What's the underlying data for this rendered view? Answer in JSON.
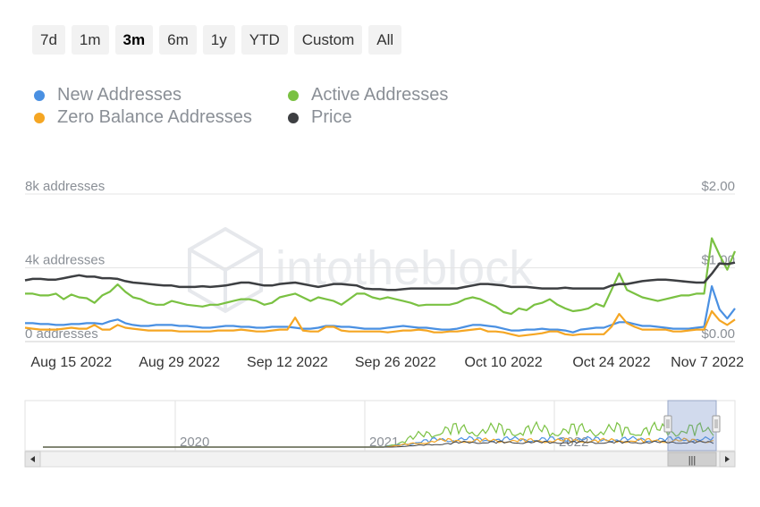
{
  "range_selector": {
    "buttons": [
      {
        "label": "7d"
      },
      {
        "label": "1m"
      },
      {
        "label": "3m"
      },
      {
        "label": "6m"
      },
      {
        "label": "1y"
      },
      {
        "label": "YTD"
      },
      {
        "label": "Custom"
      },
      {
        "label": "All"
      }
    ],
    "active": "3m"
  },
  "legend": {
    "items": [
      {
        "label": "New Addresses",
        "color": "#4a90e2"
      },
      {
        "label": "Active Addresses",
        "color": "#7ac142"
      },
      {
        "label": "Zero Balance Addresses",
        "color": "#f5a623"
      },
      {
        "label": "Price",
        "color": "#3d3f42"
      }
    ]
  },
  "watermark": "intotheblock",
  "navigator": {
    "year_labels": [
      "2020",
      "2021",
      "2022"
    ],
    "scroll_handle": "|||"
  },
  "chart_data": {
    "type": "line",
    "x_dates": [
      "2022-08-09",
      "2022-08-10",
      "2022-08-11",
      "2022-08-12",
      "2022-08-13",
      "2022-08-14",
      "2022-08-15",
      "2022-08-16",
      "2022-08-17",
      "2022-08-18",
      "2022-08-19",
      "2022-08-20",
      "2022-08-21",
      "2022-08-22",
      "2022-08-23",
      "2022-08-24",
      "2022-08-25",
      "2022-08-26",
      "2022-08-27",
      "2022-08-28",
      "2022-08-29",
      "2022-08-30",
      "2022-08-31",
      "2022-09-01",
      "2022-09-02",
      "2022-09-03",
      "2022-09-04",
      "2022-09-05",
      "2022-09-06",
      "2022-09-07",
      "2022-09-08",
      "2022-09-09",
      "2022-09-10",
      "2022-09-11",
      "2022-09-12",
      "2022-09-13",
      "2022-09-14",
      "2022-09-15",
      "2022-09-16",
      "2022-09-17",
      "2022-09-18",
      "2022-09-19",
      "2022-09-20",
      "2022-09-21",
      "2022-09-22",
      "2022-09-23",
      "2022-09-24",
      "2022-09-25",
      "2022-09-26",
      "2022-09-27",
      "2022-09-28",
      "2022-09-29",
      "2022-09-30",
      "2022-10-01",
      "2022-10-02",
      "2022-10-03",
      "2022-10-04",
      "2022-10-05",
      "2022-10-06",
      "2022-10-07",
      "2022-10-08",
      "2022-10-09",
      "2022-10-10",
      "2022-10-11",
      "2022-10-12",
      "2022-10-13",
      "2022-10-14",
      "2022-10-15",
      "2022-10-16",
      "2022-10-17",
      "2022-10-18",
      "2022-10-19",
      "2022-10-20",
      "2022-10-21",
      "2022-10-22",
      "2022-10-23",
      "2022-10-24",
      "2022-10-25",
      "2022-10-26",
      "2022-10-27",
      "2022-10-28",
      "2022-10-29",
      "2022-10-30",
      "2022-10-31",
      "2022-11-01",
      "2022-11-02",
      "2022-11-03",
      "2022-11-04",
      "2022-11-05",
      "2022-11-06",
      "2022-11-07",
      "2022-11-08",
      "2022-11-09"
    ],
    "x_tick_labels": [
      {
        "label": "Aug 15 2022",
        "date": "2022-08-15"
      },
      {
        "label": "Aug 29 2022",
        "date": "2022-08-29"
      },
      {
        "label": "Sep 12 2022",
        "date": "2022-09-12"
      },
      {
        "label": "Sep 26 2022",
        "date": "2022-09-26"
      },
      {
        "label": "Oct 10 2022",
        "date": "2022-10-10"
      },
      {
        "label": "Oct 24 2022",
        "date": "2022-10-24"
      },
      {
        "label": "Nov 7 2022",
        "date": "2022-11-07"
      }
    ],
    "y_left": {
      "ticks": [
        {
          "v": 0,
          "label": "0 addresses"
        },
        {
          "v": 4000,
          "label": "4k addresses"
        },
        {
          "v": 8000,
          "label": "8k addresses"
        }
      ],
      "ylim": [
        0,
        8000
      ]
    },
    "y_right": {
      "ticks": [
        {
          "v": 0,
          "label": "$0.00"
        },
        {
          "v": 1,
          "label": "$1.00"
        },
        {
          "v": 2,
          "label": "$2.00"
        }
      ],
      "ylim": [
        0,
        2
      ]
    },
    "grid": true,
    "series": [
      {
        "name": "New Addresses",
        "axis": "left",
        "color": "#4a90e2",
        "values": [
          1000,
          1000,
          950,
          950,
          900,
          900,
          950,
          950,
          1000,
          1000,
          950,
          1100,
          1200,
          1000,
          900,
          850,
          850,
          900,
          900,
          900,
          850,
          850,
          800,
          750,
          750,
          800,
          850,
          850,
          800,
          800,
          750,
          750,
          800,
          800,
          800,
          750,
          700,
          700,
          750,
          850,
          850,
          800,
          800,
          750,
          700,
          700,
          700,
          750,
          800,
          850,
          800,
          750,
          750,
          700,
          650,
          650,
          700,
          800,
          900,
          900,
          850,
          800,
          700,
          600,
          600,
          650,
          650,
          700,
          650,
          650,
          600,
          500,
          650,
          700,
          750,
          750,
          900,
          1050,
          1050,
          950,
          850,
          850,
          800,
          750,
          700,
          700,
          700,
          750,
          800,
          3000,
          1750,
          1250,
          1800
        ]
      },
      {
        "name": "Active Addresses",
        "axis": "left",
        "color": "#7ac142",
        "values": [
          2600,
          2600,
          2500,
          2500,
          2600,
          2300,
          2550,
          2400,
          2350,
          2100,
          2500,
          2700,
          3100,
          2700,
          2400,
          2300,
          2100,
          2000,
          2000,
          2200,
          2100,
          2000,
          1950,
          1900,
          2000,
          2000,
          2100,
          2200,
          2300,
          2300,
          2200,
          2000,
          2100,
          2400,
          2500,
          2600,
          2400,
          2200,
          2400,
          2300,
          2200,
          2000,
          2300,
          2600,
          2600,
          2400,
          2300,
          2400,
          2300,
          2200,
          2100,
          1950,
          2000,
          2000,
          2000,
          2000,
          2100,
          2300,
          2400,
          2300,
          2100,
          1900,
          1600,
          1500,
          1800,
          1700,
          2000,
          2100,
          2300,
          2000,
          1800,
          1650,
          1700,
          1800,
          2050,
          1900,
          2800,
          3700,
          2800,
          2600,
          2400,
          2300,
          2200,
          2300,
          2400,
          2500,
          2500,
          2600,
          2600,
          5600,
          4700,
          3900,
          4900
        ]
      },
      {
        "name": "Zero Balance Addresses",
        "axis": "left",
        "color": "#f5a623",
        "values": [
          750,
          700,
          650,
          650,
          650,
          700,
          750,
          700,
          700,
          900,
          650,
          650,
          900,
          750,
          700,
          650,
          600,
          600,
          600,
          600,
          550,
          550,
          550,
          550,
          550,
          600,
          600,
          600,
          650,
          600,
          550,
          550,
          600,
          650,
          650,
          1300,
          600,
          550,
          550,
          800,
          800,
          600,
          550,
          550,
          550,
          550,
          550,
          500,
          550,
          600,
          600,
          650,
          600,
          500,
          500,
          550,
          550,
          600,
          650,
          700,
          550,
          550,
          500,
          400,
          300,
          350,
          400,
          450,
          550,
          550,
          400,
          350,
          400,
          400,
          400,
          400,
          800,
          1500,
          1000,
          800,
          650,
          650,
          650,
          650,
          550,
          550,
          600,
          650,
          650,
          1650,
          1150,
          900,
          1200
        ]
      },
      {
        "name": "Price",
        "axis": "right",
        "color": "#3d3f42",
        "values": [
          0.83,
          0.85,
          0.85,
          0.84,
          0.84,
          0.86,
          0.88,
          0.9,
          0.88,
          0.88,
          0.86,
          0.86,
          0.85,
          0.82,
          0.8,
          0.79,
          0.78,
          0.77,
          0.76,
          0.76,
          0.74,
          0.74,
          0.74,
          0.75,
          0.74,
          0.75,
          0.76,
          0.78,
          0.8,
          0.8,
          0.78,
          0.76,
          0.76,
          0.78,
          0.79,
          0.8,
          0.78,
          0.76,
          0.74,
          0.76,
          0.78,
          0.78,
          0.77,
          0.76,
          0.72,
          0.71,
          0.71,
          0.7,
          0.7,
          0.71,
          0.72,
          0.72,
          0.72,
          0.72,
          0.72,
          0.72,
          0.72,
          0.74,
          0.76,
          0.78,
          0.78,
          0.77,
          0.76,
          0.74,
          0.74,
          0.74,
          0.73,
          0.72,
          0.72,
          0.72,
          0.73,
          0.72,
          0.72,
          0.72,
          0.72,
          0.72,
          0.76,
          0.78,
          0.78,
          0.8,
          0.82,
          0.83,
          0.84,
          0.84,
          0.83,
          0.82,
          0.81,
          0.8,
          0.8,
          0.92,
          1.06,
          1.05,
          1.07
        ]
      }
    ]
  }
}
